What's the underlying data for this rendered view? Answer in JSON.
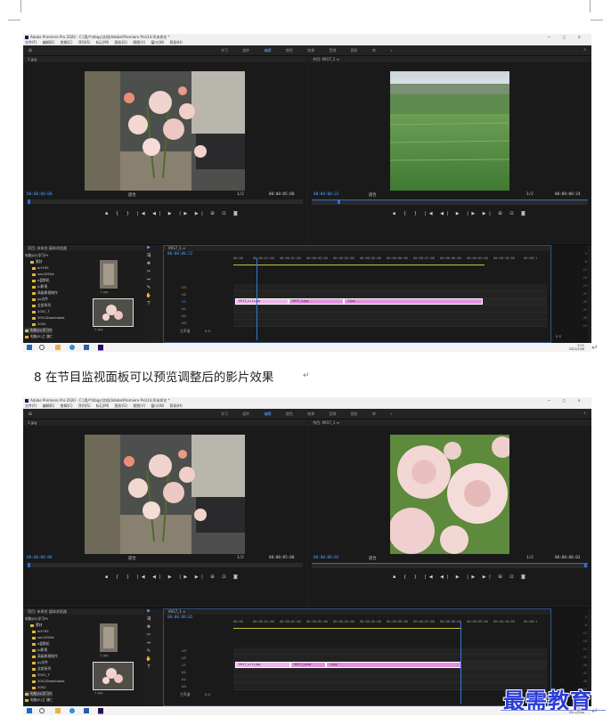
{
  "caption": "8 在节目监视面板可以预览调整后的影片效果",
  "watermark": "最需教育",
  "app": {
    "title": "Adobe Premiere Pro 2020 - C:\\用户\\hbqy\\文档\\Adobe\\Premiere Pro\\14.0\\未命名 *",
    "menu": [
      "文件(F)",
      "编辑(E)",
      "剪辑(C)",
      "序列(S)",
      "标记(M)",
      "图形(G)",
      "视图(V)",
      "窗口(W)",
      "帮助(H)"
    ],
    "workspaces": [
      "学习",
      "组件",
      "编辑",
      "颜色",
      "效果",
      "音频",
      "图形",
      "库"
    ],
    "workspace_more": "»",
    "window_controls": "— ▢ ✕"
  },
  "shot1": {
    "source_tab": "1.jpg",
    "program_tab": "节目: 0917_1 ≡",
    "source_tc_in": "00:00:00:00",
    "source_fit": "适合",
    "source_fraction": "1/2",
    "source_tc_out": "00:00:05:00",
    "program_tc_in": "00:00:00:22",
    "program_fit": "适合",
    "program_fraction": "1/2",
    "program_tc_out": "00:00:08:24",
    "project_tabs": "项目: 未命名  媒体浏览器",
    "project_path": "电脑(D)\\学习Pr",
    "timeline_tab": "0917_1 ≡",
    "timeline_tc": "00:00:00:22",
    "tree": [
      "素材",
      "art795",
      "sec2050d",
      "e盘影机",
      "Ju影视",
      "高级影视制作",
      "ps文件",
      "全部系列",
      "2001_T",
      "2001Downloads",
      "2002",
      "电脑(D)学习Pr",
      "电脑(E)之 谦仁"
    ],
    "thumb_labels": [
      "1.jpg",
      "2.jpg"
    ],
    "ruler": [
      "00:00",
      "00:00:01:00",
      "00:00:02:00",
      "00:00:03:00",
      "00:00:04:00",
      "00:00:05:00",
      "00:00:06:00",
      "00:00:07:00",
      "00:00:08:00",
      "00:00:09:00",
      "00:00:10:00",
      "00:00:1"
    ],
    "tracks": [
      "V3",
      "V2",
      "V1",
      "A1",
      "A2",
      "A3"
    ],
    "master": "主声道",
    "master_val": "0.0",
    "clips": [
      "0917_s (1).jpg",
      "0917_s.jpg",
      "1.jpg"
    ],
    "meter_ticks": [
      "0",
      "-6",
      "-12",
      "-18",
      "-24",
      "-30",
      "-36",
      "-42",
      "-48",
      "-54"
    ],
    "meter_labels": "S S",
    "time": "9:21",
    "date": "2021/10/8"
  },
  "shot2": {
    "source_tab": "1.jpg",
    "program_tab": "节目: 0917_1 ≡",
    "source_tc_in": "00:00:00:00",
    "source_fit": "适合",
    "source_fraction": "1/2",
    "source_tc_out": "00:00:05:00",
    "program_tc_in": "00:00:08:02",
    "program_fit": "适合",
    "program_fraction": "1/2",
    "program_tc_out": "00:00:08:03",
    "project_tabs": "项目: 未命名  媒体浏览器",
    "project_path": "电脑(D)\\学习Pr",
    "timeline_tab": "0917_1 ≡",
    "timeline_tc": "00:00:08:02",
    "tree": [
      "素材",
      "art795",
      "sec2050d",
      "e盘影机",
      "Ju影视",
      "高级影视制作",
      "ps文件",
      "全部系列",
      "2001_T",
      "2001Downloads",
      "2002",
      "电脑(D)学习Pr",
      "电脑(E)之 谦仁"
    ],
    "thumb_labels": [
      "1.jpg",
      "2.jpg"
    ],
    "ruler": [
      "00:00",
      "00:00:01:00",
      "00:00:02:00",
      "00:00:03:00",
      "00:00:04:00",
      "00:00:05:00",
      "00:00:06:00",
      "00:00:07:00",
      "00:00:08:00",
      "00:00:09:00",
      "00:00:10:00",
      "00:00:1"
    ],
    "tracks": [
      "V3",
      "V2",
      "V1",
      "A1",
      "A2",
      "A3"
    ],
    "master": "主声道",
    "master_val": "0.0",
    "clips": [
      "0917_s (1).jpg",
      "0917_s.psd",
      "1.jpg"
    ],
    "meter_ticks": [
      "0",
      "-6",
      "-12",
      "-18",
      "-24",
      "-30",
      "-36",
      "-42",
      "-48",
      "-54"
    ],
    "meter_labels": "S S",
    "time": "9:25",
    "date": "2021/10/8"
  },
  "transport_glyphs": "▪ { } |◀ ◀| ▶ |▶ ▶| ⊞ ⊡ ◙",
  "colors": {
    "accent_blue": "#4ea1ff",
    "clip_pink": "#e48fe0",
    "folder": "#e0b33b",
    "watermark": "#2a3bd6"
  }
}
